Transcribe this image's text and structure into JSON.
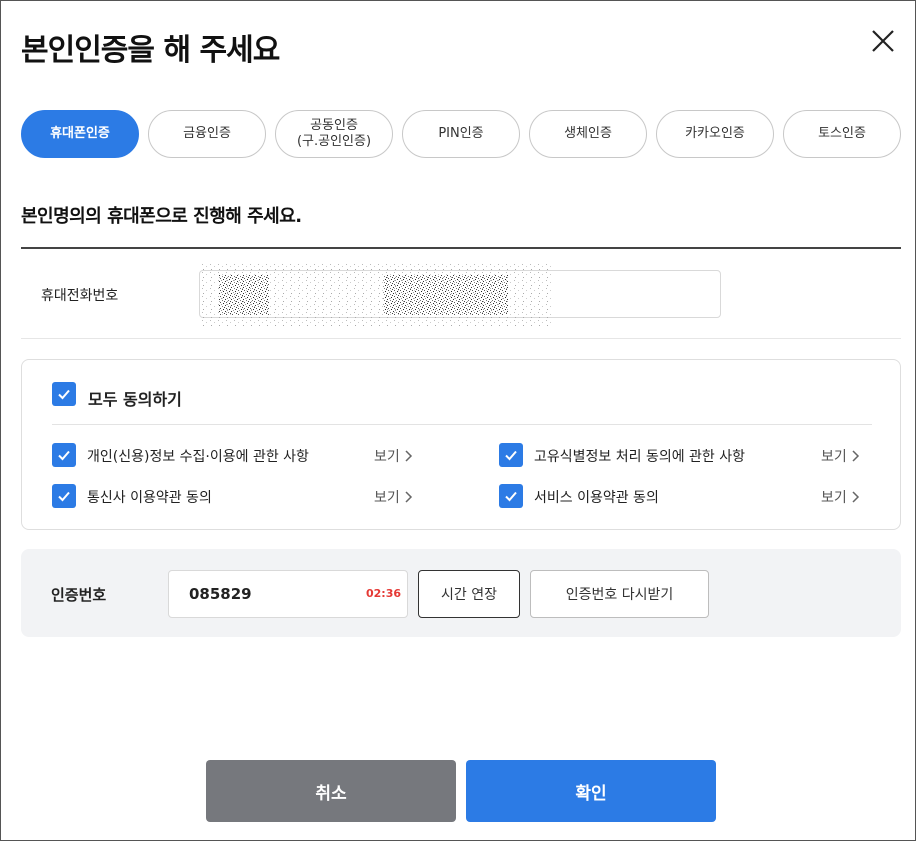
{
  "header": {
    "title": "본인인증을 해 주세요",
    "close_icon": "close-icon"
  },
  "tabs": [
    {
      "label": "휴대폰인증",
      "active": true
    },
    {
      "label": "금융인증",
      "active": false
    },
    {
      "label": "공동인증\n(구.공인인증)",
      "active": false
    },
    {
      "label": "PIN인증",
      "active": false
    },
    {
      "label": "생체인증",
      "active": false
    },
    {
      "label": "카카오인증",
      "active": false
    },
    {
      "label": "토스인증",
      "active": false
    }
  ],
  "form": {
    "subtitle": "본인명의의 휴대폰으로 진행해 주세요.",
    "phone_label": "휴대전화번호",
    "phone_value": ""
  },
  "agreements": {
    "all_label": "모두 동의하기",
    "view_label": "보기",
    "items": [
      {
        "label": "개인(신용)정보 수집·이용에 관한 사항",
        "checked": true
      },
      {
        "label": "고유식별정보 처리 동의에 관한 사항",
        "checked": true
      },
      {
        "label": "통신사 이용약관 동의",
        "checked": true
      },
      {
        "label": "서비스 이용약관 동의",
        "checked": true
      }
    ]
  },
  "verification": {
    "label": "인증번호",
    "code": "085829",
    "timer": "02:36",
    "extend_label": "시간 연장",
    "resend_label": "인증번호 다시받기"
  },
  "footer": {
    "cancel_label": "취소",
    "confirm_label": "확인"
  },
  "colors": {
    "accent": "#2c7be5",
    "cancel": "#76787d",
    "timer": "#e53935"
  }
}
